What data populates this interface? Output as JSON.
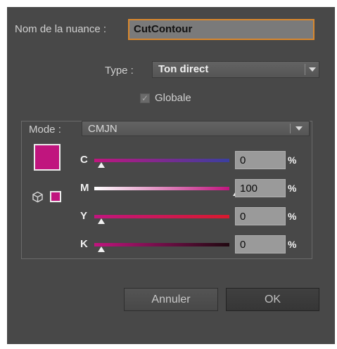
{
  "form": {
    "name_label": "Nom de la nuance :",
    "name_value": "CutContour",
    "type_label": "Type :",
    "type_value": "Ton direct",
    "global_label": "Globale",
    "global_checked": true,
    "mode_label": "Mode :",
    "mode_value": "CMJN"
  },
  "color": {
    "swatch_hex": "#c0157e"
  },
  "channels": [
    {
      "label": "C",
      "value": "0",
      "unit": "%",
      "gradient": [
        "#c0157e",
        "#3a3fa0"
      ]
    },
    {
      "label": "M",
      "value": "100",
      "unit": "%",
      "gradient": [
        "#ffffff",
        "#c0157e"
      ]
    },
    {
      "label": "Y",
      "value": "0",
      "unit": "%",
      "gradient": [
        "#c0157e",
        "#d81a2e"
      ]
    },
    {
      "label": "K",
      "value": "0",
      "unit": "%",
      "gradient": [
        "#c0157e",
        "#200810"
      ]
    }
  ],
  "buttons": {
    "cancel": "Annuler",
    "ok": "OK"
  },
  "icons": {
    "dropdown": "chevron-down-icon",
    "checkbox": "checkmark-icon",
    "gamut": "cube-icon"
  }
}
